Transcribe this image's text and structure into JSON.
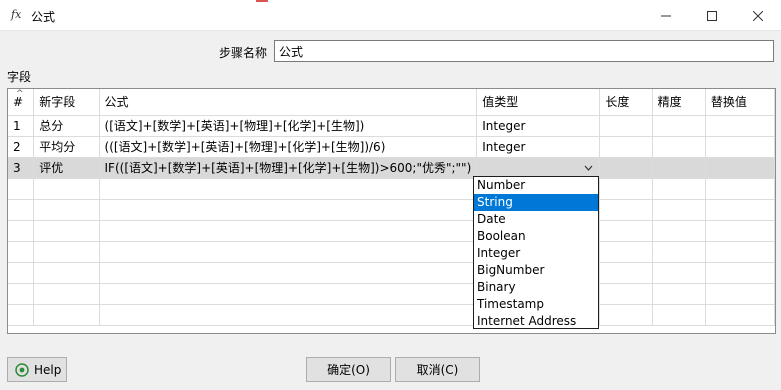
{
  "window": {
    "icon": "fx-icon",
    "icon_text": "fx",
    "title": "公式"
  },
  "step": {
    "label": "步骤名称",
    "value": "公式"
  },
  "fields": {
    "label": "字段",
    "columns": [
      "#",
      "新字段",
      "公式",
      "值类型",
      "长度",
      "精度",
      "替换值"
    ],
    "rows": [
      {
        "num": "1",
        "name": "总分",
        "formula": "([语文]+[数学]+[英语]+[物理]+[化学]+[生物])",
        "type": "Integer",
        "length": "",
        "precision": "",
        "replace": ""
      },
      {
        "num": "2",
        "name": "平均分",
        "formula": "(([语文]+[数学]+[英语]+[物理]+[化学]+[生物])/6)",
        "type": "Integer",
        "length": "",
        "precision": "",
        "replace": ""
      },
      {
        "num": "3",
        "name": "评优",
        "formula": "IF(([语文]+[数学]+[英语]+[物理]+[化学]+[生物])>600;\"优秀\";\"\")",
        "type": "",
        "length": "",
        "precision": "",
        "replace": ""
      }
    ]
  },
  "type_dropdown": {
    "options": [
      "Number",
      "String",
      "Date",
      "Boolean",
      "Integer",
      "BigNumber",
      "Binary",
      "Timestamp",
      "Internet Address"
    ],
    "highlighted": "String"
  },
  "buttons": {
    "help": "Help",
    "ok": "确定(O)",
    "cancel": "取消(C)"
  },
  "colors": {
    "selection": "#0078d7",
    "selected_row": "#d9d9d9",
    "help_icon": "#2e8b3a"
  }
}
